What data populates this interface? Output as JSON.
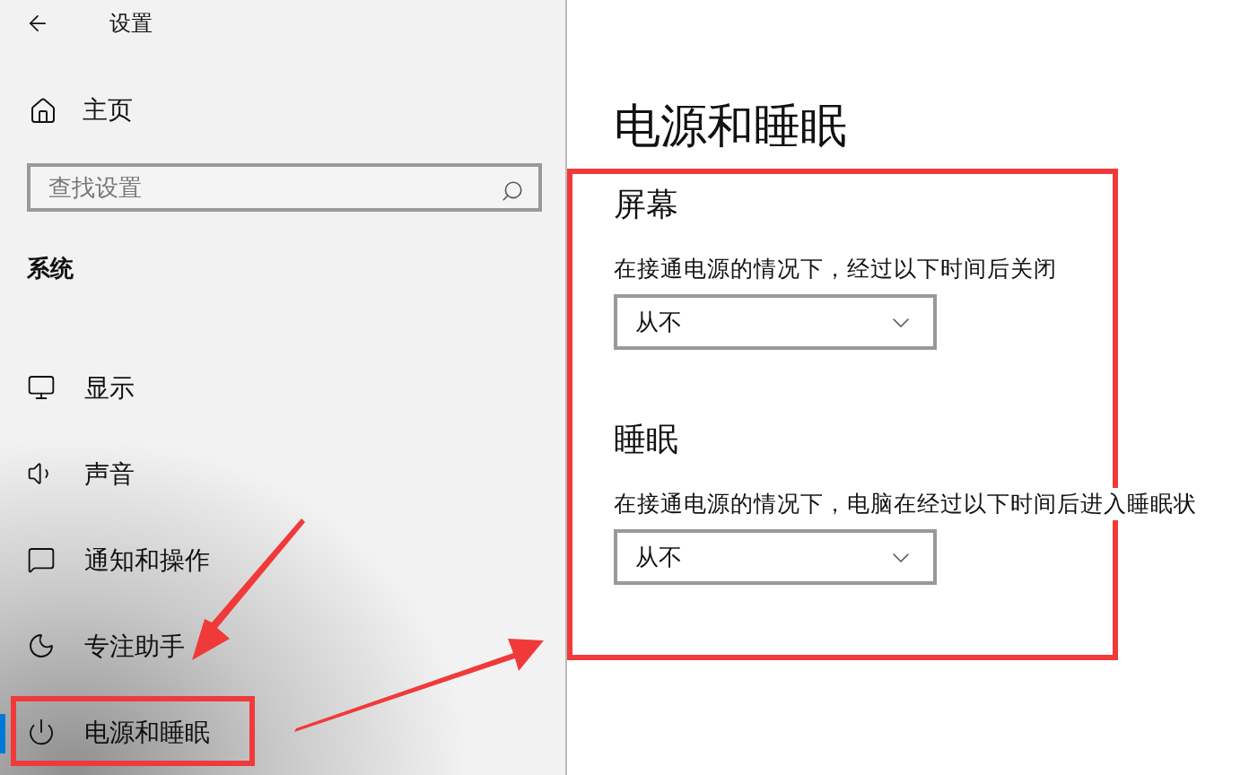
{
  "window": {
    "title": "设置"
  },
  "sidebar": {
    "home": "主页",
    "search": {
      "placeholder": "查找设置"
    },
    "section_title": "系统",
    "items": [
      {
        "label": "显示",
        "selected": false
      },
      {
        "label": "声音",
        "selected": false
      },
      {
        "label": "通知和操作",
        "selected": false
      },
      {
        "label": "专注助手",
        "selected": false
      },
      {
        "label": "电源和睡眠",
        "selected": true
      }
    ]
  },
  "page": {
    "title": "电源和睡眠",
    "sections": [
      {
        "title": "屏幕",
        "description": "在接通电源的情况下，经过以下时间后关闭",
        "dropdown": "从不"
      },
      {
        "title": "睡眠",
        "description": "在接通电源的情况下，电脑在经过以下时间后进入睡眠状",
        "dropdown": "从不"
      }
    ]
  }
}
